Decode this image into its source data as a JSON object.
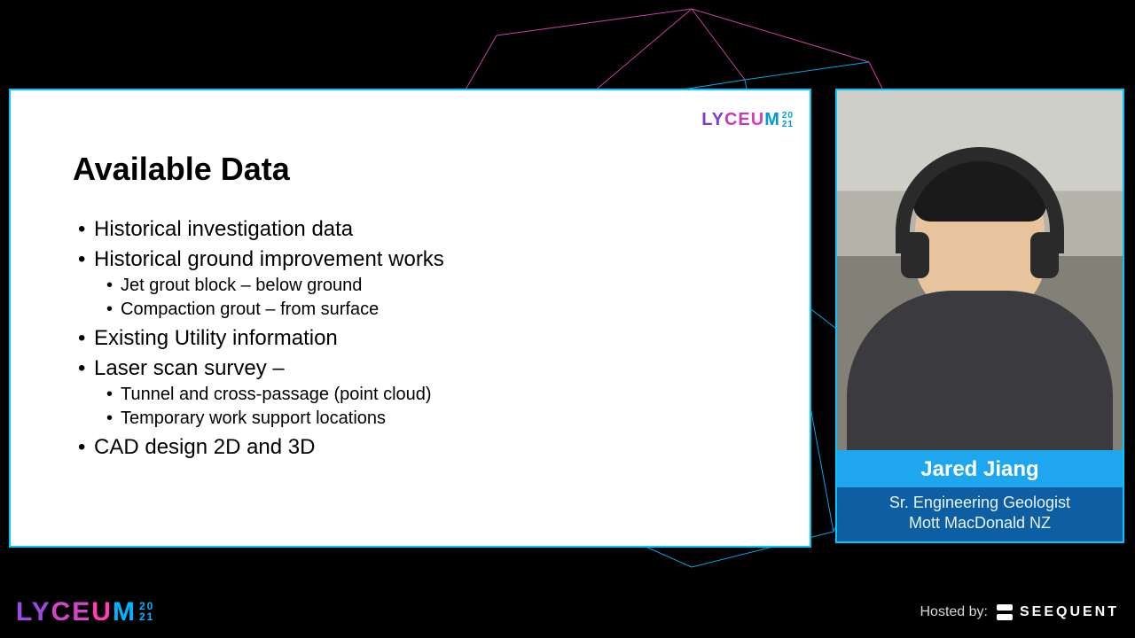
{
  "event": {
    "brand": "LYCEUM",
    "year_top": "20",
    "year_bottom": "21"
  },
  "slide": {
    "title": "Available Data",
    "bullets": [
      {
        "text": "Historical investigation data"
      },
      {
        "text": "Historical ground improvement works",
        "sub": [
          "Jet grout block – below ground",
          "Compaction grout – from surface"
        ]
      },
      {
        "text": "Existing Utility information"
      },
      {
        "text": "Laser scan survey –",
        "sub": [
          "Tunnel and cross-passage (point cloud)",
          "Temporary work support locations"
        ]
      },
      {
        "text": "CAD design 2D and 3D"
      }
    ]
  },
  "speaker": {
    "name": "Jared Jiang",
    "role_line1": "Sr. Engineering Geologist",
    "role_line2": "Mott MacDonald NZ"
  },
  "footer": {
    "hosted_label": "Hosted by:",
    "host_brand": "SEEQUENT"
  }
}
